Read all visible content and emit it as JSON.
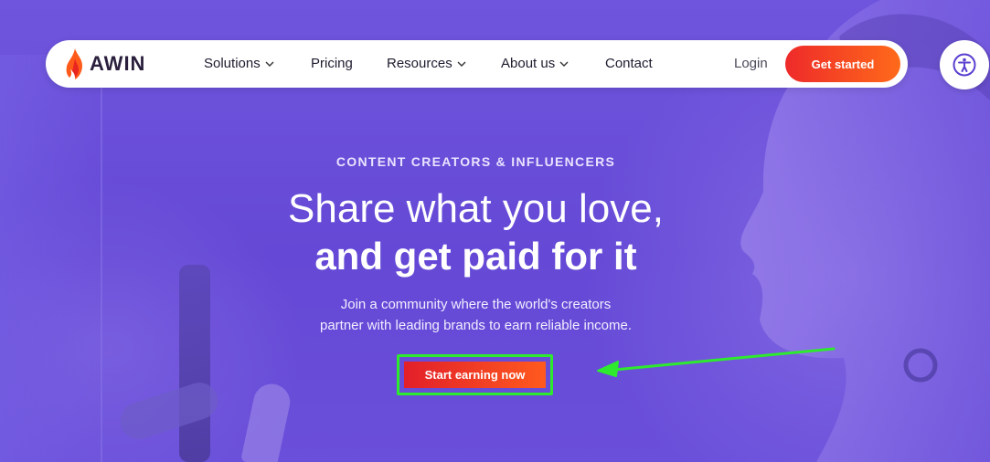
{
  "nav": {
    "logo_text": "AWIN",
    "items": [
      {
        "label": "Solutions",
        "has_dropdown": true
      },
      {
        "label": "Pricing",
        "has_dropdown": false
      },
      {
        "label": "Resources",
        "has_dropdown": true
      },
      {
        "label": "About us",
        "has_dropdown": true
      },
      {
        "label": "Contact",
        "has_dropdown": false
      }
    ],
    "login_label": "Login",
    "cta_label": "Get started"
  },
  "hero": {
    "eyebrow": "CONTENT CREATORS & INFLUENCERS",
    "headline_line1": "Share what you love,",
    "headline_line2": "and get paid for it",
    "subtext_line1": "Join a community where the world's creators",
    "subtext_line2": "partner with leading brands to earn reliable income.",
    "cta_label": "Start earning now"
  },
  "icons": {
    "accessibility": "accessibility-icon",
    "dropdown": "chevron-down-icon",
    "logo": "awin-flame-logo-icon"
  },
  "colors": {
    "hero_bg": "#6a4fd6",
    "cta_gradient_start": "#e21f2a",
    "cta_gradient_end": "#ff5a1e",
    "highlight_outline": "#2eea2e",
    "annotation_arrow": "#2eea2e"
  }
}
